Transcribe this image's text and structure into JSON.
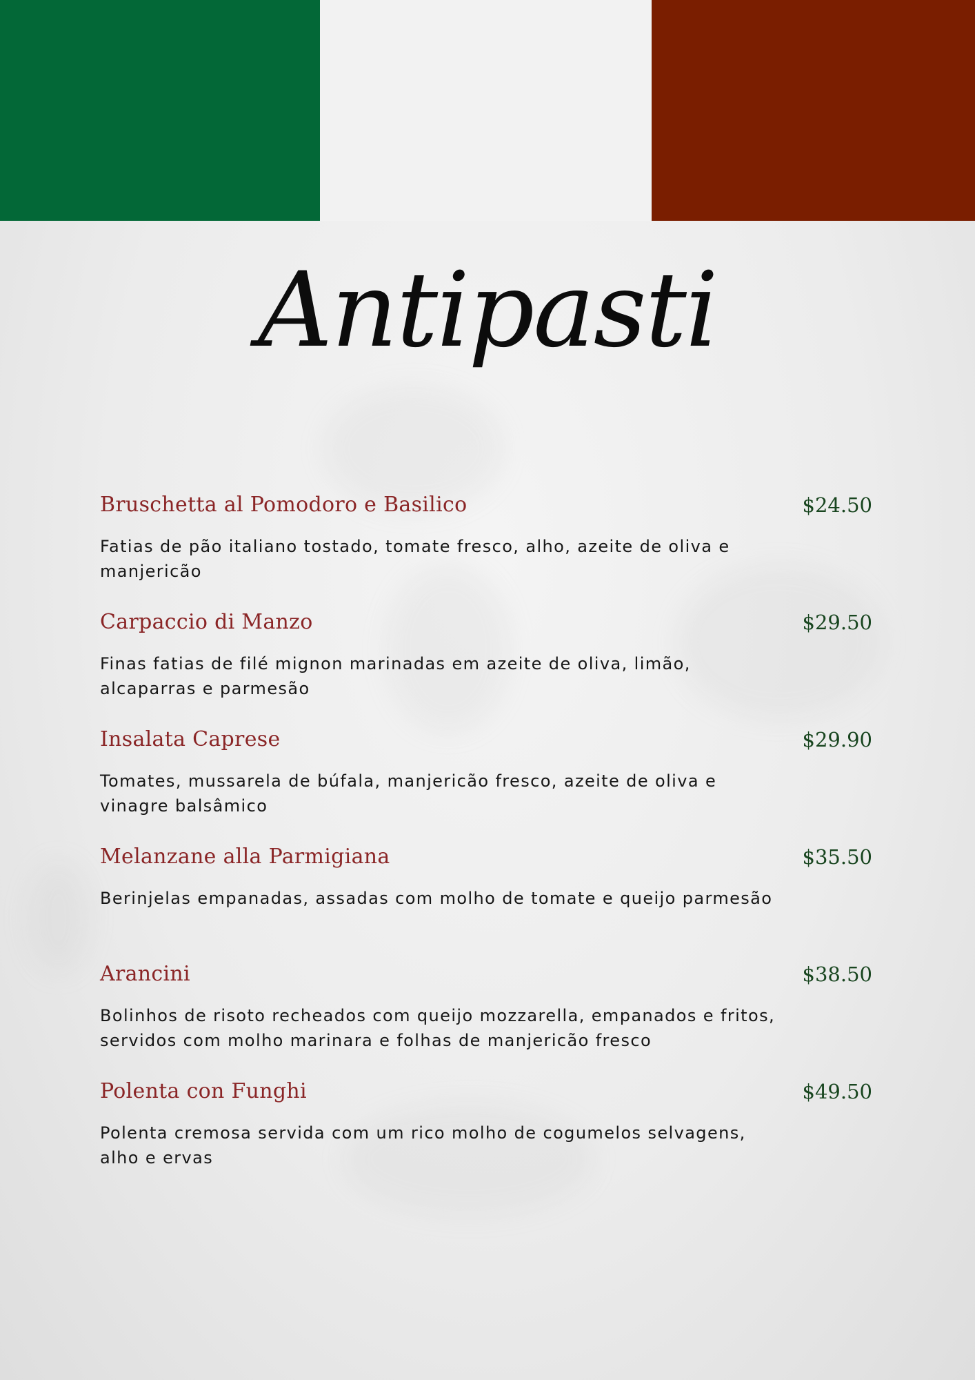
{
  "colors": {
    "flag_green": "#036837",
    "flag_white": "#f2f2f2",
    "flag_red": "#7a1e00",
    "item_name": "#8a2526",
    "item_price": "#18451f"
  },
  "menu": {
    "title": "Antipasti",
    "items": [
      {
        "name": "Bruschetta al Pomodoro e Basilico",
        "price": "$24.50",
        "description": "Fatias de pão italiano tostado, tomate fresco, alho, azeite de oliva e manjericão"
      },
      {
        "name": "Carpaccio di Manzo",
        "price": "$29.50",
        "description": "Finas fatias de filé mignon marinadas em azeite de oliva, limão, alcaparras e parmesão"
      },
      {
        "name": "Insalata Caprese",
        "price": "$29.90",
        "description": "Tomates, mussarela de búfala, manjericão fresco, azeite de oliva e vinagre balsâmico"
      },
      {
        "name": "Melanzane alla Parmigiana",
        "price": "$35.50",
        "description": "Berinjelas empanadas, assadas com molho de tomate e queijo parmesão"
      },
      {
        "name": "Arancini",
        "price": "$38.50",
        "description": "Bolinhos de risoto recheados com queijo mozzarella, empanados e fritos, servidos com molho marinara e folhas de manjericão fresco"
      },
      {
        "name": "Polenta con Funghi",
        "price": "$49.50",
        "description": "Polenta cremosa servida com um rico molho de cogumelos selvagens, alho e ervas"
      }
    ]
  }
}
